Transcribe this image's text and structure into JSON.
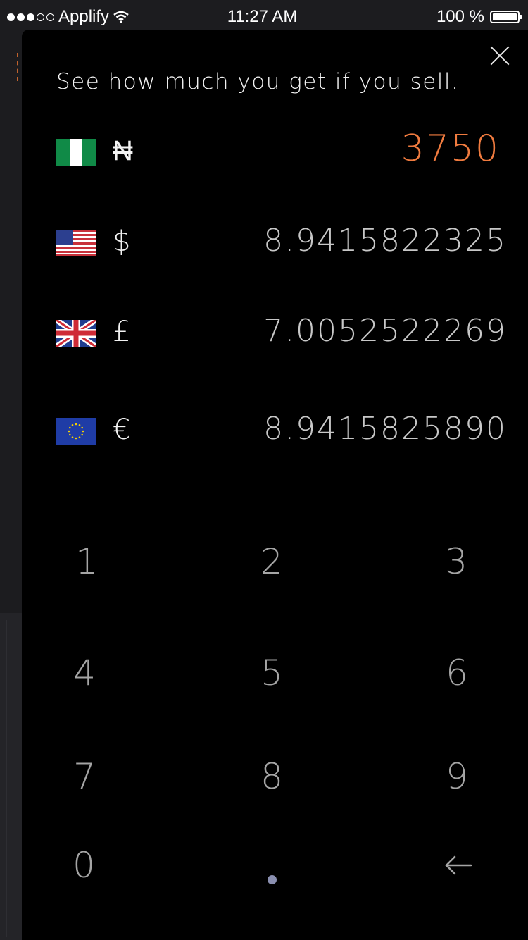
{
  "status_bar": {
    "carrier": "Applify",
    "time": "11:27 AM",
    "battery": "100 %"
  },
  "modal": {
    "heading": "See how much you get if you sell.",
    "currencies": [
      {
        "flag": "nigeria-flag",
        "symbol": "₦",
        "value": "3750",
        "active": true
      },
      {
        "flag": "usa-flag",
        "symbol": "$",
        "value": "8.9415822325"
      },
      {
        "flag": "uk-flag",
        "symbol": "£",
        "value": "7.0052522269"
      },
      {
        "flag": "eu-flag",
        "symbol": "€",
        "value": "8.9415825890"
      }
    ],
    "keypad": [
      "1",
      "2",
      "3",
      "4",
      "5",
      "6",
      "7",
      "8",
      "9",
      "0",
      ".",
      "←"
    ]
  },
  "colors": {
    "accent": "#f07b3f",
    "background": "#000000"
  }
}
